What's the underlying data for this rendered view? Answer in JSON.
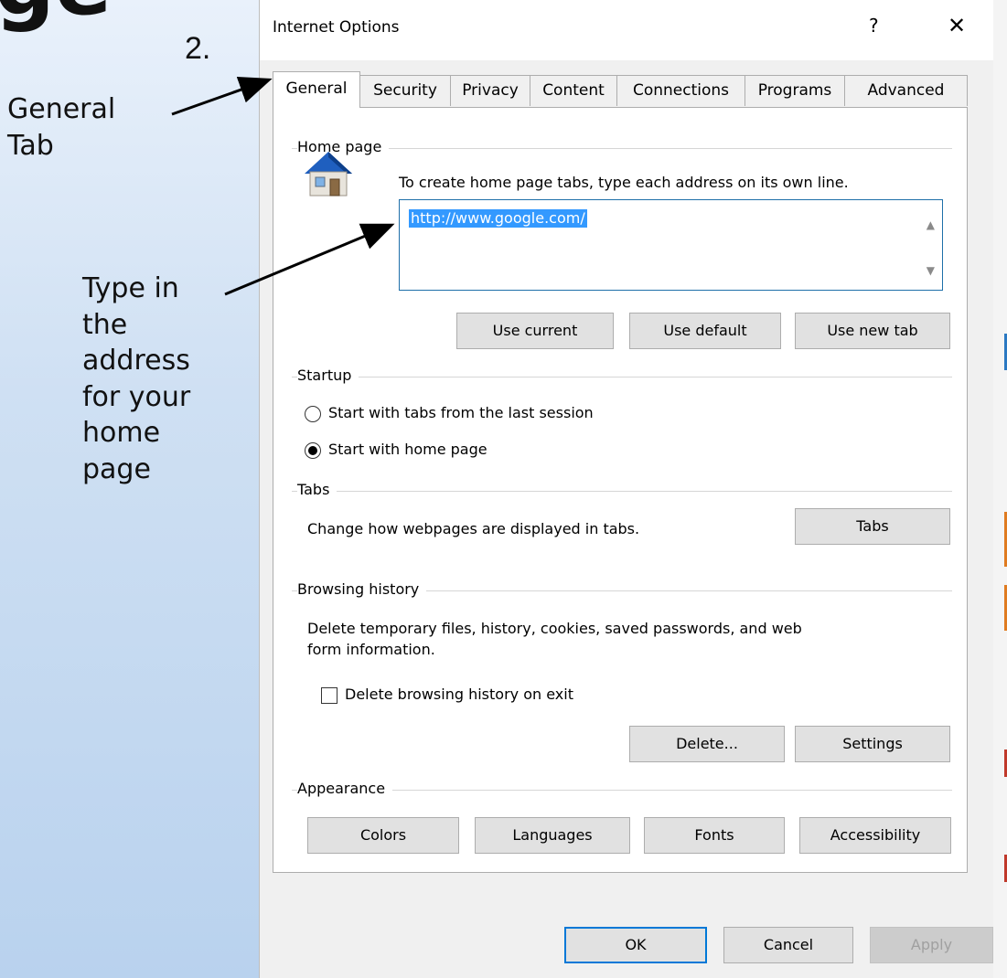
{
  "slide": {
    "title_fragment": "ge",
    "step_number": "2.",
    "callout_general": [
      "General",
      "Tab"
    ],
    "callout_address": [
      "Type in",
      "the",
      "address",
      "for your",
      "home",
      "page"
    ]
  },
  "dialog": {
    "title": "Internet Options",
    "help_glyph": "?",
    "close_glyph": "✕",
    "tabs": [
      "General",
      "Security",
      "Privacy",
      "Content",
      "Connections",
      "Programs",
      "Advanced"
    ],
    "active_tab": "General",
    "home_page": {
      "label": "Home page",
      "instruction": "To create home page tabs, type each address on its own line.",
      "url": "http://www.google.com/",
      "buttons": {
        "use_current": "Use current",
        "use_default": "Use default",
        "use_new_tab": "Use new tab"
      }
    },
    "startup": {
      "label": "Startup",
      "options": [
        "Start with tabs from the last session",
        "Start with home page"
      ],
      "selected": 1
    },
    "tabs_group": {
      "label": "Tabs",
      "description": "Change how webpages are displayed in tabs.",
      "button": "Tabs"
    },
    "browsing_history": {
      "label": "Browsing history",
      "description_line1": "Delete temporary files, history, cookies, saved passwords, and web",
      "description_line2": "form information.",
      "checkbox_label": "Delete browsing history on exit",
      "checked": false,
      "buttons": {
        "delete": "Delete...",
        "settings": "Settings"
      }
    },
    "appearance": {
      "label": "Appearance",
      "buttons": {
        "colors": "Colors",
        "languages": "Languages",
        "fonts": "Fonts",
        "accessibility": "Accessibility"
      }
    },
    "footer": {
      "ok": "OK",
      "cancel": "Cancel",
      "apply": "Apply"
    }
  },
  "colors": {
    "accent_blue": "#0078d7",
    "selection_blue": "#3399ff",
    "url_border": "#1e6fa9",
    "icon_house_roof": "#1f5fbf"
  }
}
